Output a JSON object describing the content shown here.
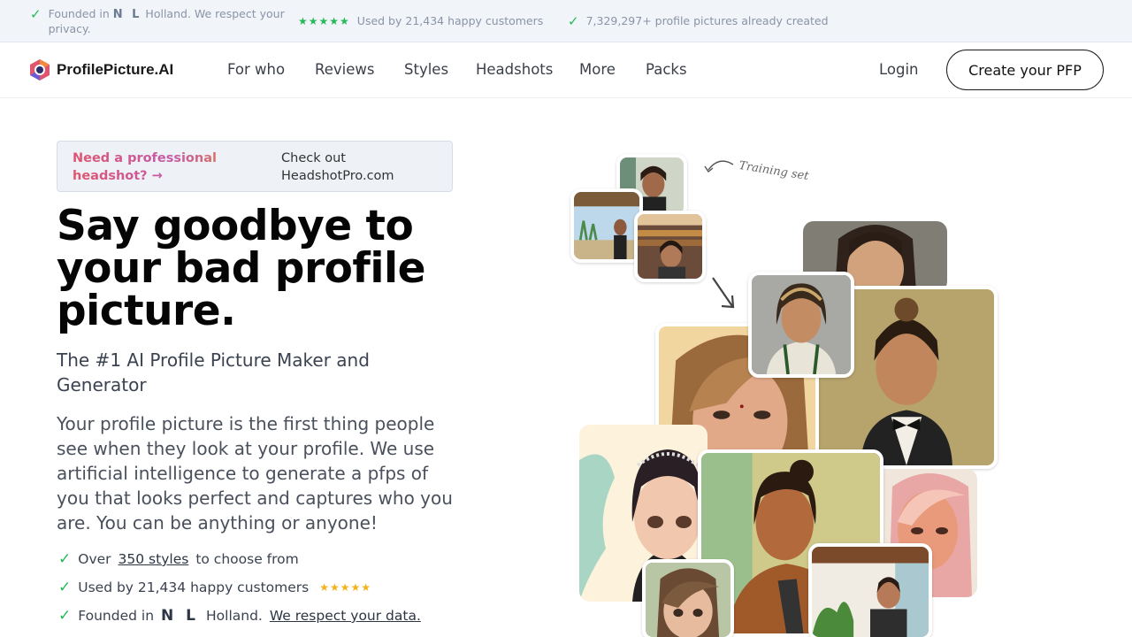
{
  "topbar": {
    "founded_pre": "Founded in",
    "nl": "N L",
    "founded_post": "Holland. We respect your privacy.",
    "stars": "★★★★★",
    "customers": "Used by 21,434 happy customers",
    "created": "7,329,297+ profile pictures already created"
  },
  "nav": {
    "brand": "ProfilePicture.AI",
    "links": [
      "For who",
      "Reviews",
      "Styles",
      "Headshots",
      "More",
      "Packs"
    ],
    "login": "Login",
    "cta": "Create your PFP"
  },
  "promo": {
    "left": "Need a professional headshot? →",
    "right": "Check out HeadshotPro.com"
  },
  "hero": {
    "title": "Say goodbye to your bad profile picture.",
    "subtitle": "The #1 AI Profile Picture Maker and Generator",
    "description": "Your profile picture is the first thing people see when they look at your profile. We use artificial intelligence to generate a pfps of you that looks perfect and captures who you are. You can be anything or anyone!",
    "features": {
      "f1_pre": "Over",
      "f1_link": "350 styles",
      "f1_post": "to choose from",
      "f2": "Used by 21,434 happy customers",
      "f2_stars": "★★★★★",
      "f3_pre": "Founded in",
      "f3_nl": "N L",
      "f3_mid": "Holland.",
      "f3_link": "We respect your data."
    },
    "training_label": "Training set"
  },
  "colors": {
    "accent_green": "#26b85a",
    "star_gold": "#f3b21b",
    "promo_gradient": [
      "#e0556e",
      "#c55aa8",
      "#e87b3d"
    ]
  }
}
